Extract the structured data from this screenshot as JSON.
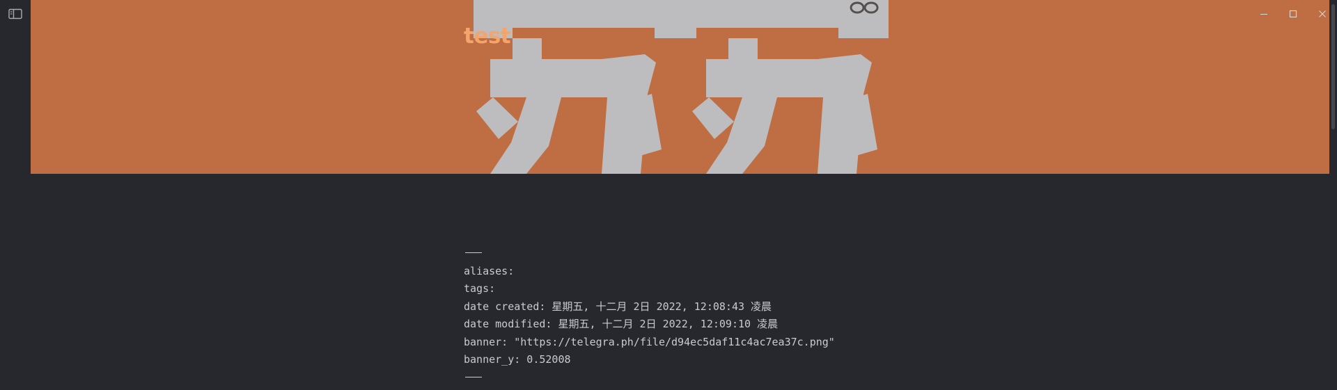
{
  "note": {
    "title": "test"
  },
  "ribbon": {
    "toggle_icon": "sidebar-toggle-icon"
  },
  "window_controls": {
    "minimize_icon": "minimize-icon",
    "maximize_icon": "maximize-icon",
    "close_icon": "close-icon"
  },
  "banner": {
    "background_color": "#bf6d42",
    "glyph_color": "#bdbdbf",
    "title_color": "#f4a56b"
  },
  "frontmatter": {
    "aliases": "aliases:",
    "tags": "tags:",
    "date_created": "date created: 星期五, 十二月 2日 2022, 12:08:43 凌晨",
    "date_modified": "date modified: 星期五, 十二月 2日 2022, 12:09:10 凌晨",
    "banner": "banner: \"https://telegra.ph/file/d94ec5daf11c4ac7ea37c.png\"",
    "banner_y": "banner_y: 0.52008"
  }
}
